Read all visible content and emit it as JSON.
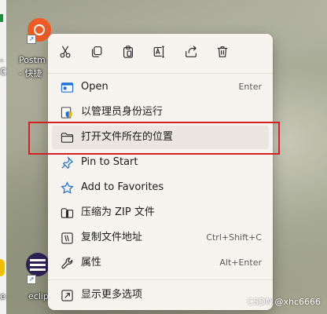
{
  "desktop": {
    "icons": [
      {
        "label_line1": "Postm",
        "label_line2": "- 快捷"
      },
      {
        "label_line1": "eclip"
      }
    ],
    "left_fragments": [
      "-",
      "C",
      "e"
    ]
  },
  "context_menu": {
    "quick_actions": [
      {
        "name": "cut",
        "icon": "scissors-icon"
      },
      {
        "name": "copy",
        "icon": "copy-icon"
      },
      {
        "name": "paste",
        "icon": "clipboard-icon"
      },
      {
        "name": "rename",
        "icon": "rename-icon"
      },
      {
        "name": "share",
        "icon": "share-icon"
      },
      {
        "name": "delete",
        "icon": "trash-icon"
      }
    ],
    "items": [
      {
        "label": "Open",
        "accel": "Enter",
        "icon": "app-window-icon"
      },
      {
        "label": "以管理员身份运行",
        "accel": "",
        "icon": "shield-icon"
      },
      {
        "label": "打开文件所在的位置",
        "accel": "",
        "icon": "folder-icon"
      },
      {
        "label": "Pin to Start",
        "accel": "",
        "icon": "pin-icon"
      },
      {
        "label": "Add to Favorites",
        "accel": "",
        "icon": "star-icon"
      },
      {
        "label": "压缩为 ZIP 文件",
        "accel": "",
        "icon": "zip-icon"
      },
      {
        "label": "复制文件地址",
        "accel": "Ctrl+Shift+C",
        "icon": "copy-path-icon"
      },
      {
        "label": "属性",
        "accel": "Alt+Enter",
        "icon": "wrench-icon"
      },
      {
        "label": "显示更多选项",
        "accel": "",
        "icon": "more-options-icon"
      }
    ]
  },
  "watermark": "CSDN @xhc6666",
  "colors": {
    "menu_bg": "#f7f4ef",
    "highlight_border": "#d61f26",
    "icon_blue": "#1a6fd8"
  }
}
